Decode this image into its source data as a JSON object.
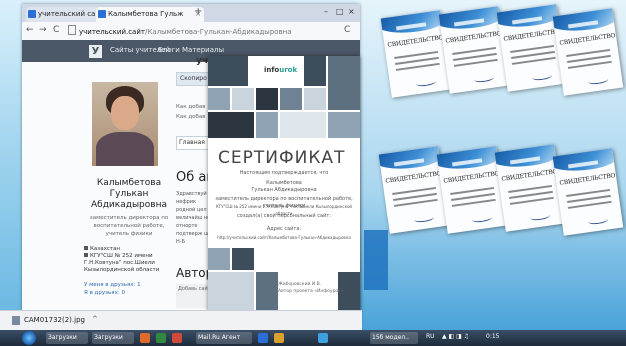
{
  "browser": {
    "tabs": [
      {
        "label": "учительский сайт"
      },
      {
        "label": "Калымбетова Гульж"
      }
    ],
    "url_domain": "учительский.сайт",
    "url_path": "/Калымбетова-Гулькан-Абдикадыровна",
    "site_nav": [
      "Сайты учителей",
      "Блоги",
      "Материалы"
    ],
    "site_logo": "У"
  },
  "profile": {
    "name_line1": "Калымбетова",
    "name_line2": "Гулькан",
    "name_line3": "Абдикадыровна",
    "role_line1": "заместитель директора по",
    "role_line2": "воспитательной работе,",
    "role_line3": "учитель физики",
    "location_line1": "Казахстан",
    "location_line2": "КГУ\"СШ № 252 имени",
    "location_line3": "Г.Н.Ковтуна\" пос.Шиели",
    "location_line4": "Кызылординской области",
    "friends": "У меня в друзьях: 1",
    "friend_of": "Я в друзьях: 0"
  },
  "main": {
    "teacher_heading": "учител",
    "copy_button": "Скопиро",
    "added_line1": "Как добав",
    "added_line2": "Как добав",
    "tab_main": "Главная",
    "about_heading": "Об ав",
    "about_text": "Здравствуй и нефрик родной цел величайш не отнорте подтверж щий Н-Б",
    "author_heading": "Автор",
    "add_text": "Добавь сайт"
  },
  "certificate": {
    "logo_prefix": "info",
    "logo_accent": "urok",
    "title": "СЕРТИФИКАТ",
    "confirms": "Настоящим подтверждается, что",
    "person_line1": "Калымбетова",
    "person_line2": "Гулькан Абдикадыровна",
    "position": "заместитель директора по воспитательной работе, учитель физики",
    "school": "КГУ\"СШ № 252 имени Г.Н.Ковтуна\" пос.Шиели Кызылординской области",
    "created": "создал(а) свой персональный сайт:",
    "address_label": "Адрес сайта:",
    "address": "http://учительский.сайт/Калымбетова-Гулькан-Абдикадыровна",
    "director_line1": "Жаборовский И.В.",
    "director_line2": "Автор проекта «Инфоурок»"
  },
  "svidetelstvo": {
    "title": "СВИДЕТЕЛЬСТВО",
    "count": 8
  },
  "downloads": {
    "file_name": "CAM01732(2).jpg"
  },
  "taskbar": {
    "items": [
      "Загрузки",
      "Загрузки",
      "Mail.Ru Агент",
      "15б модел.."
    ],
    "tray_lang": "RU",
    "time": "0:15"
  },
  "colors": {
    "site_nav": "#4a5766",
    "taskbar": "#1d2b3b",
    "accent_blue": "#1e73be"
  }
}
